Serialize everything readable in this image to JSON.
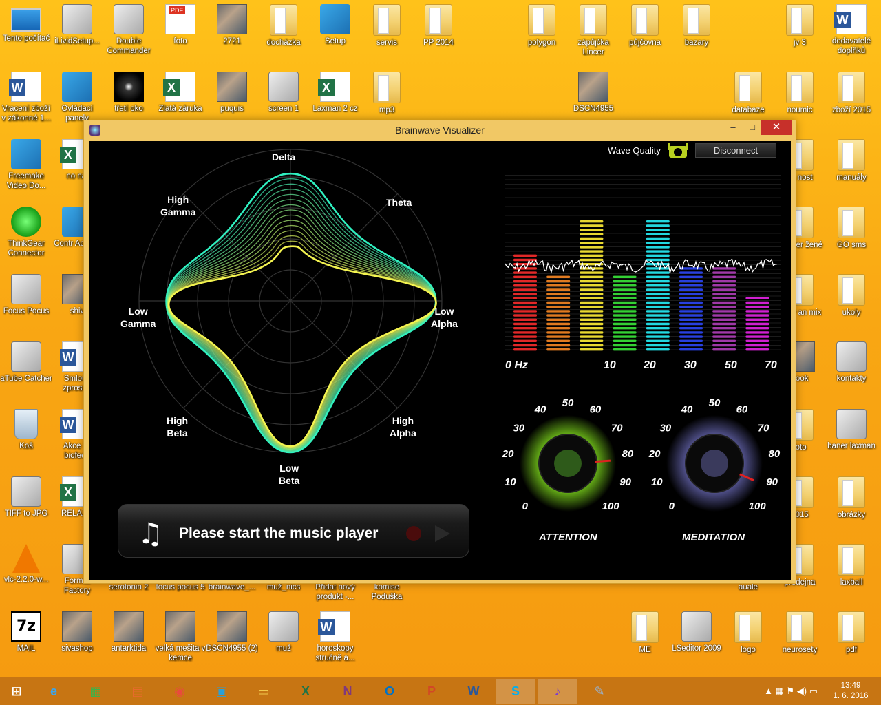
{
  "desktop": {
    "icons_top": [
      {
        "label": "Tento počítač",
        "kind": "computer"
      },
      {
        "label": "iLividSetup...",
        "kind": "generic"
      },
      {
        "label": "Double Commander",
        "kind": "generic"
      },
      {
        "label": "foto",
        "kind": "pdf"
      },
      {
        "label": "2721",
        "kind": "photo"
      },
      {
        "label": "docházka",
        "kind": "folder"
      },
      {
        "label": "Setup",
        "kind": "blue"
      },
      {
        "label": "servis",
        "kind": "folder"
      },
      {
        "label": "PP 2014",
        "kind": "folder"
      },
      {
        "label": "polygon",
        "kind": "folder"
      },
      {
        "label": "zápůjčka Lincer",
        "kind": "folder"
      },
      {
        "label": "půjčovna",
        "kind": "folder"
      },
      {
        "label": "bazary",
        "kind": "folder"
      },
      {
        "label": "jv 3",
        "kind": "folder"
      },
      {
        "label": "dodavatelé doplňků",
        "kind": "word"
      }
    ],
    "icons_row2": [
      {
        "label": "Vracení zboží v zákonné 1...",
        "kind": "word"
      },
      {
        "label": "Ovládací panely",
        "kind": "blue"
      },
      {
        "label": "třetí oko",
        "kind": "dark"
      },
      {
        "label": "Zlatá záruka",
        "kind": "excel"
      },
      {
        "label": "puquis",
        "kind": "photo"
      },
      {
        "label": "screen 1",
        "kind": "generic"
      },
      {
        "label": "Laxman 2 cz",
        "kind": "excel"
      },
      {
        "label": "mp3",
        "kind": "folder"
      },
      {
        "label": "DSCN4955",
        "kind": "photo"
      },
      {
        "label": "databaze",
        "kind": "folder"
      },
      {
        "label": "noumic",
        "kind": "folder"
      },
      {
        "label": "zboží 2015",
        "kind": "folder"
      }
    ],
    "icons_left": [
      {
        "label": "Freemake Video Do...",
        "kind": "blue"
      },
      {
        "label": "ThinkGear Connector",
        "kind": "green"
      },
      {
        "label": "Focus Pocus",
        "kind": "generic"
      },
      {
        "label": "aTube Catcher",
        "kind": "generic"
      },
      {
        "label": "Koš",
        "kind": "trash"
      },
      {
        "label": "TIFF to JPG",
        "kind": "generic"
      },
      {
        "label": "vlc-2.2.0-w...",
        "kind": "vlc"
      },
      {
        "label": "MAIL",
        "kind": "zip"
      }
    ],
    "icons_left2": [
      {
        "label": "no nal",
        "kind": "excel"
      },
      {
        "label": "Contr Activex",
        "kind": "blue"
      },
      {
        "label": "shiv",
        "kind": "photo"
      },
      {
        "label": "Smlouv zprostře",
        "kind": "word"
      },
      {
        "label": "Akce kv biofeed",
        "kind": "word"
      },
      {
        "label": "RELAXN",
        "kind": "excel"
      },
      {
        "label": "Format Factory",
        "kind": "generic"
      }
    ],
    "icons_right": [
      {
        "label": "manuály",
        "kind": "folder"
      },
      {
        "label": "GO sms",
        "kind": "folder"
      },
      {
        "label": "ukoly",
        "kind": "folder"
      },
      {
        "label": "kontakty",
        "kind": "generic"
      },
      {
        "label": "baner laxman",
        "kind": "generic"
      },
      {
        "label": "obrázky",
        "kind": "folder"
      },
      {
        "label": "laxball",
        "kind": "folder"
      },
      {
        "label": "pdf",
        "kind": "folder"
      }
    ],
    "icons_right2": [
      {
        "label": "vá nost",
        "kind": "folder"
      },
      {
        "label": "nplayer žené",
        "kind": "folder"
      },
      {
        "label": "ramy an mix",
        "kind": "folder"
      },
      {
        "label": "book",
        "kind": "photo"
      },
      {
        "label": "foto",
        "kind": "folder"
      },
      {
        "label": "2015",
        "kind": "folder"
      },
      {
        "label": "prodejna",
        "kind": "folder"
      },
      {
        "label": "neurosety",
        "kind": "folder"
      }
    ],
    "icons_bottom": [
      {
        "label": "sivashop",
        "kind": "photo"
      },
      {
        "label": "antarktida",
        "kind": "photo"
      },
      {
        "label": "velká mešita v kemce",
        "kind": "photo"
      },
      {
        "label": "DSCN4955 (2)",
        "kind": "photo"
      },
      {
        "label": "muž",
        "kind": "generic"
      },
      {
        "label": "horoskopy stručně a...",
        "kind": "word"
      },
      {
        "label": "ME",
        "kind": "folder"
      },
      {
        "label": "LSeditor 2009",
        "kind": "generic"
      },
      {
        "label": "logo",
        "kind": "folder"
      }
    ],
    "icons_behind": [
      "serotonin 2",
      "focus pocus 5",
      "brainwave_...",
      "muž_nics",
      "Přidat nový produkt -...",
      "komise Poduška",
      "auale"
    ]
  },
  "window": {
    "title": "Brainwave Visualizer",
    "minimize": "▭",
    "maximize": "□",
    "close": "✕"
  },
  "radar": {
    "labels": {
      "delta": "Delta",
      "theta": "Theta",
      "low_alpha": "Low\nAlpha",
      "high_alpha": "High\nAlpha",
      "low_beta": "Low\nBeta",
      "high_beta": "High\nBeta",
      "low_gamma": "Low\nGamma",
      "high_gamma": "High\nGamma"
    },
    "outer_color": "#2ff0c0",
    "inner_color": "#f4ff50"
  },
  "status": {
    "wave_quality_label": "Wave Quality",
    "disconnect_label": "Disconnect"
  },
  "spectrum": {
    "x_labels": [
      "0 Hz",
      "10",
      "20",
      "30",
      "50",
      "70"
    ],
    "bars": [
      {
        "color": "#e22828",
        "level": 0.74
      },
      {
        "color": "#e07a20",
        "level": 0.58
      },
      {
        "color": "#e8d830",
        "level": 1.0
      },
      {
        "color": "#34d034",
        "level": 0.58
      },
      {
        "color": "#22d8e0",
        "level": 1.0
      },
      {
        "color": "#2840e0",
        "level": 0.64
      },
      {
        "color": "#a038a8",
        "level": 0.64
      },
      {
        "color": "#d020d0",
        "level": 0.42
      }
    ]
  },
  "gauges": {
    "attention": {
      "title": "ATTENTION",
      "value": 82,
      "glow": "#8cf020",
      "ticks": [
        "0",
        "10",
        "20",
        "30",
        "40",
        "50",
        "60",
        "70",
        "80",
        "90",
        "100"
      ]
    },
    "meditation": {
      "title": "MEDITATION",
      "value": 92,
      "glow": "#7070c0",
      "ticks": [
        "0",
        "10",
        "20",
        "30",
        "40",
        "50",
        "60",
        "70",
        "80",
        "90",
        "100"
      ]
    }
  },
  "music": {
    "message": "Please start the music player",
    "note_glyph": "♫"
  },
  "taskbar": {
    "items": [
      "⊞",
      "e",
      "▦",
      "▤",
      "◉",
      "▣",
      "▭",
      "X",
      "N",
      "O",
      "P",
      "W",
      "S",
      "♪",
      "✎"
    ],
    "tray_glyphs": "▲ ▦ ⚑ ◀) ▭",
    "time": "13:49",
    "date": "1. 6. 2016"
  }
}
